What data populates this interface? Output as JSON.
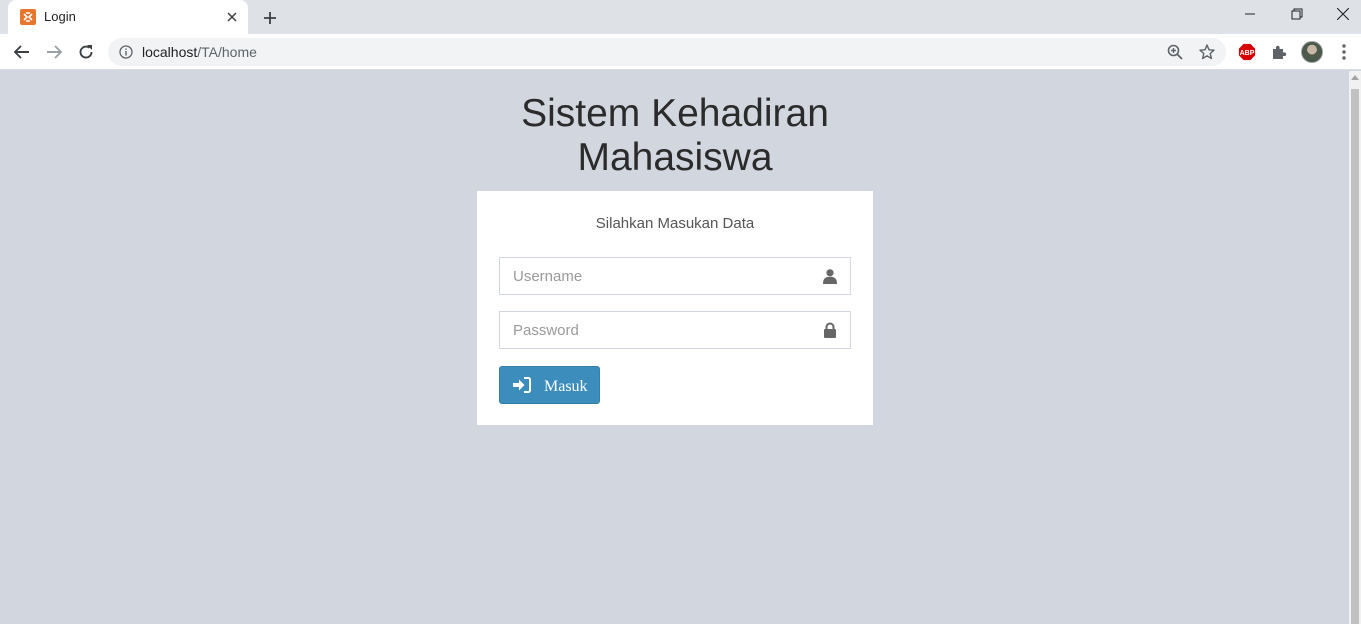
{
  "browser": {
    "tab_title": "Login",
    "url_host": "localhost",
    "url_path": "/TA/home",
    "abp_label": "ABP",
    "icons": [
      "xampp-favicon",
      "close-icon",
      "plus-icon",
      "minimize-icon",
      "maximize-icon",
      "window-close-icon",
      "back-arrow-icon",
      "forward-arrow-icon",
      "reload-icon",
      "info-icon",
      "zoom-icon",
      "star-icon",
      "adblock-icon",
      "puzzle-icon",
      "kebab-menu-icon"
    ]
  },
  "page": {
    "title_line1": "Sistem Kehadiran",
    "title_line2": "Mahasiswa",
    "box_message": "Silahkan Masukan Data",
    "username": {
      "value": "",
      "placeholder": "Username",
      "icon": "user-icon"
    },
    "password": {
      "value": "",
      "placeholder": "Password",
      "icon": "lock-icon"
    },
    "submit_label": "Masuk",
    "submit_icon": "sign-in-icon"
  },
  "colors": {
    "page_background": "#d2d6de",
    "button_primary": "#3c8dbc",
    "favicon": "#e8762d",
    "abp_red": "#d60000"
  }
}
